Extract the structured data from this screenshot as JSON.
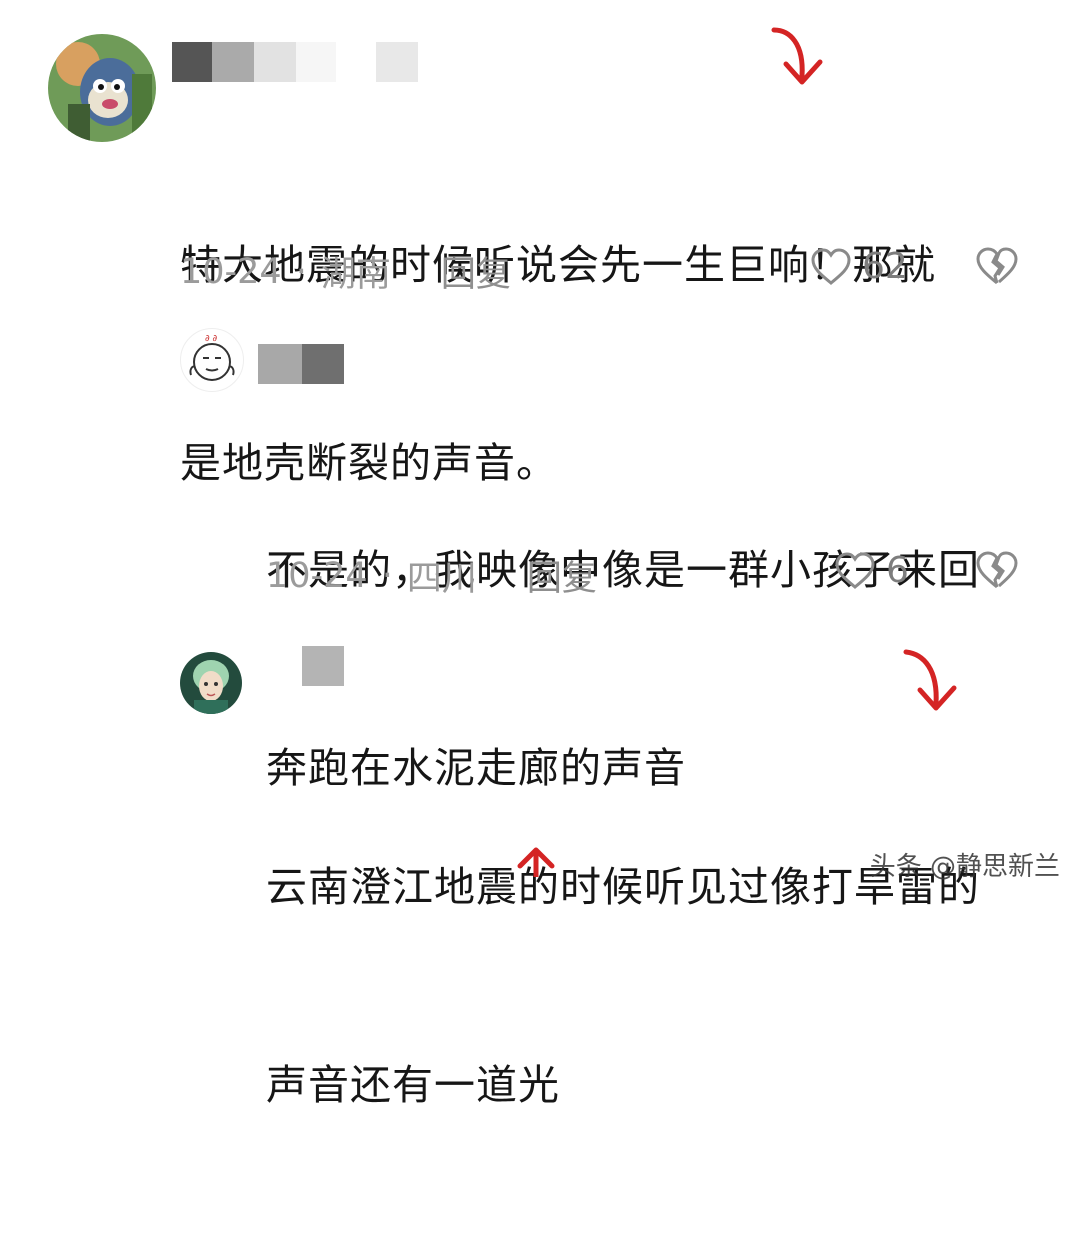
{
  "comments": [
    {
      "text_line1": "特大地震的时候听说会先一生巨响！那就",
      "text_line2": "是地壳断裂的声音。",
      "date": "10-24",
      "region": "湖南",
      "separator": "·",
      "reply_label": "回复",
      "likes": "62"
    },
    {
      "text_line1": "不是的，我映像中像是一群小孩子来回",
      "text_line2": "奔跑在水泥走廊的声音",
      "date": "10-24",
      "region": "四川",
      "separator": "·",
      "reply_label": "回复",
      "likes": "6"
    },
    {
      "text_line1": "云南澄江地震的时候听见过像打旱雷的",
      "text_line2": "声音还有一道光"
    }
  ],
  "watermark": "头条 @静思新兰",
  "colors": {
    "annotation_red": "#d42424",
    "meta_gray": "#9b9b9b"
  }
}
